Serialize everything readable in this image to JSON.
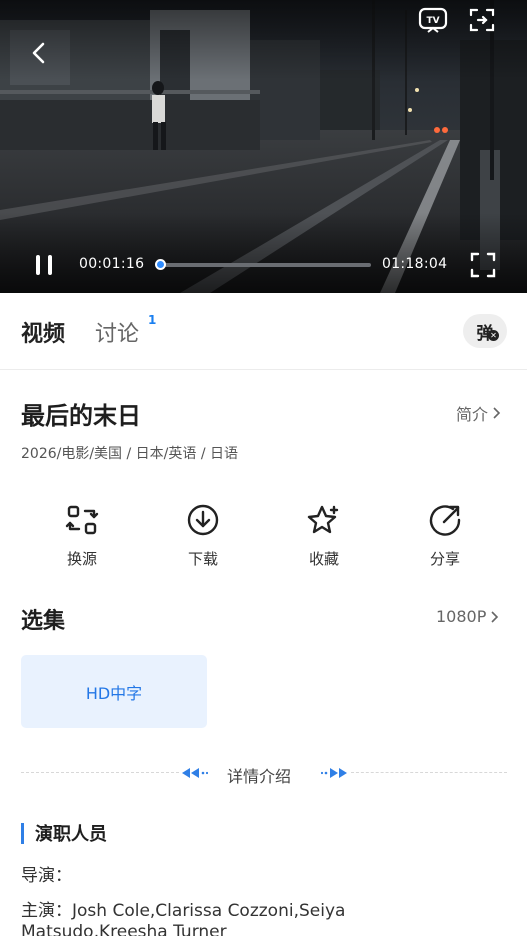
{
  "player": {
    "current_time": "00:01:16",
    "total_time": "01:18:04",
    "progress": 0.016,
    "state": "playing",
    "icons": {
      "back": "back-arrow-icon",
      "tv": "tv-cast-icon",
      "pip": "picture-in-picture-icon",
      "pause": "pause-icon",
      "fullscreen": "fullscreen-icon"
    }
  },
  "tabs": [
    {
      "label": "视频",
      "active": true
    },
    {
      "label": "讨论",
      "badge": "1",
      "active": false
    }
  ],
  "danmaku": {
    "label": "弹",
    "icon": "danmaku-toggle-icon"
  },
  "movie": {
    "title": "最后的末日",
    "intro_link": "简介",
    "meta": "2026/电影/美国 / 日本/英语 / 日语"
  },
  "actions": [
    {
      "label": "换源",
      "icon": "switch-source-icon"
    },
    {
      "label": "下载",
      "icon": "download-icon"
    },
    {
      "label": "收藏",
      "icon": "favorite-star-icon"
    },
    {
      "label": "分享",
      "icon": "share-icon"
    }
  ],
  "episodes": {
    "title": "选集",
    "quality": "1080P",
    "items": [
      {
        "label": "HD中字",
        "selected": true
      }
    ]
  },
  "details": {
    "divider_label": "详情介绍"
  },
  "cast": {
    "title": "演职人员",
    "director_line": "导演：",
    "actors_line_1": "主演：Josh Cole,Clarissa Cozzoni,Seiya",
    "actors_line_2": "Matsudo,Kreesha Turner"
  },
  "colors": {
    "accent": "#2f8cff",
    "chip_bg": "#e9f2fe",
    "chip_text": "#2377e6"
  }
}
